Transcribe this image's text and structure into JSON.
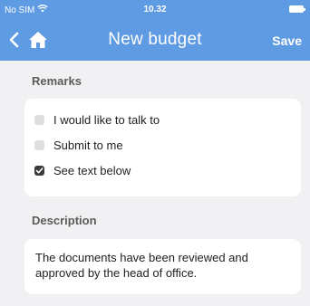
{
  "status": {
    "carrier": "No SIM",
    "time": "10.32",
    "wifi_icon": "wifi-icon",
    "battery_icon": "battery-icon"
  },
  "navbar": {
    "title": "New budget",
    "save_label": "Save",
    "back_icon": "chevron-left-icon",
    "home_icon": "home-icon",
    "background": "#5f9be3"
  },
  "remarks": {
    "label": "Remarks",
    "options": [
      {
        "label": "I would like to talk to",
        "checked": false
      },
      {
        "label": "Submit to me",
        "checked": false
      },
      {
        "label": "See text below",
        "checked": true
      }
    ]
  },
  "description": {
    "label": "Description",
    "text": "The documents have been reviewed and approved by the head of office."
  }
}
